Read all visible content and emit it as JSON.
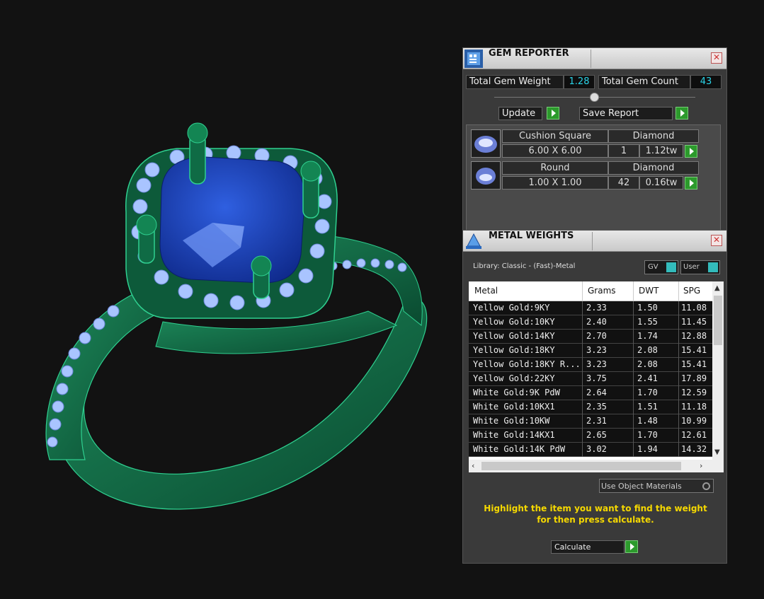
{
  "gem_reporter": {
    "title": "GEM REPORTER",
    "close": "✕",
    "total_weight_label": "Total Gem Weight",
    "total_weight_value": "1.28",
    "total_count_label": "Total Gem Count",
    "total_count_value": "43",
    "update_label": "Update",
    "save_label": "Save Report",
    "gems": [
      {
        "shape": "Cushion Square",
        "type": "Diamond",
        "size": "6.00 X 6.00",
        "count": "1",
        "weight": "1.12tw"
      },
      {
        "shape": "Round",
        "type": "Diamond",
        "size": "1.00 X 1.00",
        "count": "42",
        "weight": "0.16tw"
      }
    ]
  },
  "metal_weights": {
    "title": "METAL WEIGHTS",
    "close": "✕",
    "library": "Library: Classic - (Fast)-Metal",
    "gv_label": "GV",
    "user_label": "User",
    "columns": [
      "Metal",
      "Grams",
      "DWT",
      "SPG"
    ],
    "rows": [
      [
        "Yellow Gold:9KY",
        "2.33",
        "1.50",
        "11.08"
      ],
      [
        "Yellow Gold:10KY",
        "2.40",
        "1.55",
        "11.45"
      ],
      [
        "Yellow Gold:14KY",
        "2.70",
        "1.74",
        "12.88"
      ],
      [
        "Yellow Gold:18KY",
        "3.23",
        "2.08",
        "15.41"
      ],
      [
        "Yellow Gold:18KY R...",
        "3.23",
        "2.08",
        "15.41"
      ],
      [
        "Yellow Gold:22KY",
        "3.75",
        "2.41",
        "17.89"
      ],
      [
        "White Gold:9K PdW",
        "2.64",
        "1.70",
        "12.59"
      ],
      [
        "White Gold:10KX1",
        "2.35",
        "1.51",
        "11.18"
      ],
      [
        "White Gold:10KW",
        "2.31",
        "1.48",
        "10.99"
      ],
      [
        "White Gold:14KX1",
        "2.65",
        "1.70",
        "12.61"
      ],
      [
        "White Gold:14K PdW",
        "3.02",
        "1.94",
        "14.32"
      ]
    ],
    "use_object_materials": "Use Object Materials",
    "instructions": "Highlight the item you want to find the weight for then press calculate.",
    "calculate_label": "Calculate"
  },
  "colors": {
    "metal": "#0f6b45",
    "center_stone": "#1b3fb8",
    "side_stones": "#a9c4ff",
    "accent": "#2ad4e8",
    "highlight_text": "#f5d800"
  }
}
